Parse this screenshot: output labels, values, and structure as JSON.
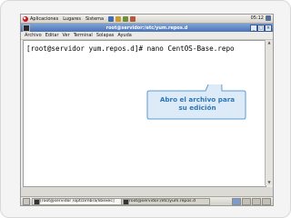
{
  "top_panel": {
    "menus": [
      "Aplicaciones",
      "Lugares",
      "Sistema"
    ],
    "clock": "05:12"
  },
  "window": {
    "title": "root@servidor:/etc/yum.repos.d",
    "menu": [
      "Archivo",
      "Editar",
      "Ver",
      "Terminal",
      "Solapas",
      "Ayuda"
    ],
    "minimize": "_",
    "maximize": "□",
    "close": "×"
  },
  "terminal": {
    "command_line": "[root@servidor yum.repos.d]# nano CentOS-Base.repo"
  },
  "callout": {
    "text": "Abro el archivo para su edición"
  },
  "taskbar": {
    "tasks": [
      "[root@servidor /opt/zimbra/libexec]",
      "root@servidor:/etc/yum.repos.d"
    ]
  },
  "colors": {
    "callout_fill": "#dcebf7",
    "callout_text": "#2e75b6",
    "titlebar": "#4b74b6"
  }
}
